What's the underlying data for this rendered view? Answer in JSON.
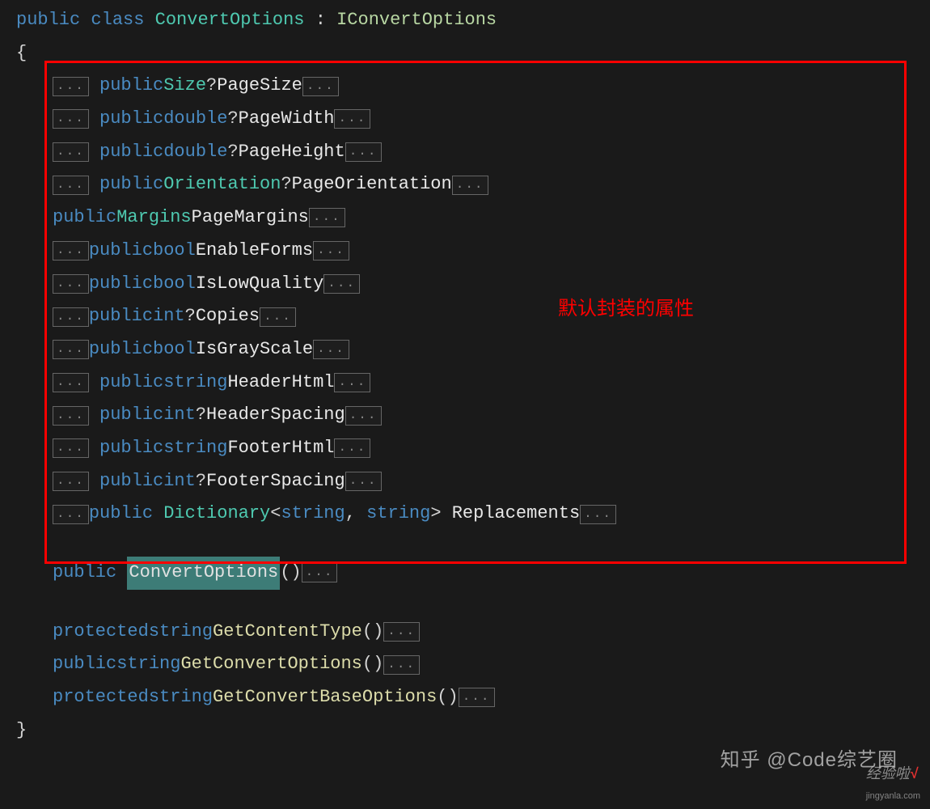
{
  "header": {
    "public": "public",
    "class": "class",
    "className": "ConvertOptions",
    "colon": ":",
    "interfaceName": "IConvertOptions"
  },
  "brace_open": "{",
  "brace_close": "}",
  "fold": "...",
  "annotation_label": "默认封装的属性",
  "properties": [
    {
      "indent": true,
      "access": "public",
      "type": "Size",
      "typeClass": "type-name",
      "nullable": "?",
      "name": "PageSize",
      "foldBefore": true,
      "foldAfter": true
    },
    {
      "indent": true,
      "access": "public",
      "type": "double",
      "typeClass": "kw-double",
      "nullable": "?",
      "name": "PageWidth",
      "foldBefore": true,
      "foldAfter": true
    },
    {
      "indent": true,
      "access": "public",
      "type": "double",
      "typeClass": "kw-double",
      "nullable": "?",
      "name": "PageHeight",
      "foldBefore": true,
      "foldAfter": true
    },
    {
      "indent": true,
      "access": "public",
      "type": "Orientation",
      "typeClass": "type-name",
      "nullable": "?",
      "name": "PageOrientation",
      "foldBefore": true,
      "foldAfter": true
    },
    {
      "indent": false,
      "access": "public",
      "type": "Margins",
      "typeClass": "type-name",
      "nullable": "",
      "name": "PageMargins",
      "foldBefore": false,
      "foldAfter": true
    },
    {
      "indent": false,
      "access": "public",
      "type": "bool",
      "typeClass": "kw-bool",
      "nullable": "",
      "name": "EnableForms",
      "foldBefore": true,
      "foldAfter": true
    },
    {
      "indent": false,
      "access": "public",
      "type": "bool",
      "typeClass": "kw-bool",
      "nullable": "",
      "name": "IsLowQuality",
      "foldBefore": true,
      "foldAfter": true
    },
    {
      "indent": false,
      "access": "public",
      "type": "int",
      "typeClass": "kw-int",
      "nullable": "?",
      "name": "Copies",
      "foldBefore": true,
      "foldAfter": true
    },
    {
      "indent": false,
      "access": "public",
      "type": "bool",
      "typeClass": "kw-bool",
      "nullable": "",
      "name": "IsGrayScale",
      "foldBefore": true,
      "foldAfter": true
    },
    {
      "indent": true,
      "access": "public",
      "type": "string",
      "typeClass": "kw-string",
      "nullable": "",
      "name": "HeaderHtml",
      "foldBefore": true,
      "foldAfter": true
    },
    {
      "indent": true,
      "access": "public",
      "type": "int",
      "typeClass": "kw-int",
      "nullable": "?",
      "name": "HeaderSpacing",
      "foldBefore": true,
      "foldAfter": true
    },
    {
      "indent": true,
      "access": "public",
      "type": "string",
      "typeClass": "kw-string",
      "nullable": "",
      "name": "FooterHtml",
      "foldBefore": true,
      "foldAfter": true
    },
    {
      "indent": true,
      "access": "public",
      "type": "int",
      "typeClass": "kw-int",
      "nullable": "?",
      "name": "FooterSpacing",
      "foldBefore": true,
      "foldAfter": true
    }
  ],
  "dictionary_line": {
    "access": "public",
    "type": "Dictionary",
    "generic_open": "<",
    "gtype1": "string",
    "comma": ",",
    "gtype2": "string",
    "generic_close": ">",
    "name": "Replacements"
  },
  "constructor": {
    "access": "public",
    "name": "ConvertOptions",
    "parens": "()"
  },
  "methods": [
    {
      "access": "protected",
      "returnType": "string",
      "name": "GetContentType",
      "parens": "()"
    },
    {
      "access": "public",
      "returnType": "string",
      "name": "GetConvertOptions",
      "parens": "()"
    },
    {
      "access": "protected",
      "returnType": "string",
      "name": "GetConvertBaseOptions",
      "parens": "()"
    }
  ],
  "watermark1": "知乎 @Code综艺圈",
  "watermark2_text": "经验啦",
  "watermark2_suffix": "√",
  "watermark2_domain": "jingyanla.com"
}
